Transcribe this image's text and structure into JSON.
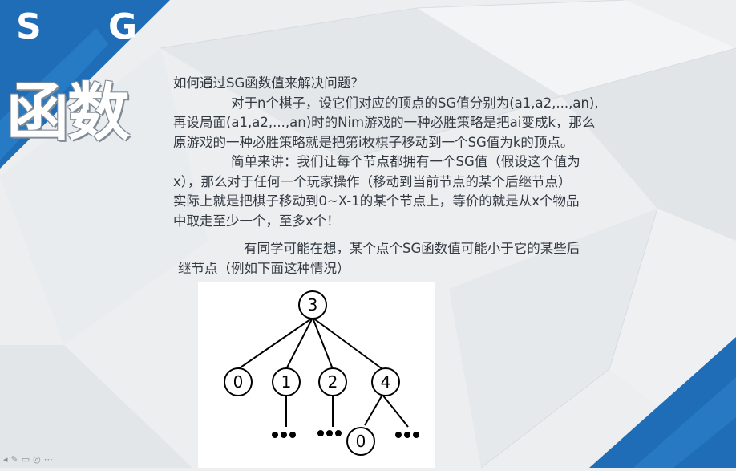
{
  "title": {
    "line1": "S G",
    "line2": "函数"
  },
  "content": {
    "lines": [
      "如何通过SG函数值来解决问题？",
      "对于n个棋子，设它们对应的顶点的SG值分别为(a1,a2,...,an),",
      "再设局面(a1,a2,...,an)时的Nim游戏的一种必胜策略是把ai变成k，那么",
      "原游戏的一种必胜策略就是把第i枚棋子移动到一个SG值为k的顶点。",
      "简单来讲：我们让每个节点都拥有一个SG值（假设这个值为",
      "x），那么对于任何一个玩家操作（移动到当前节点的某个后继节点）",
      "实际上就是把棋子移动到0~X-1的某个节点上，等价的就是从x个物品",
      "中取走至少一个，至多x个！",
      "有同学可能在想，某个点个SG函数值可能小于它的某些后",
      "继节点（例如下面这种情况）"
    ]
  },
  "tree": {
    "root": "3",
    "children": [
      "0",
      "1",
      "2",
      "4"
    ],
    "grandchild": "0"
  },
  "colors": {
    "accent": "#1f6fb8",
    "text": "#333a42"
  }
}
